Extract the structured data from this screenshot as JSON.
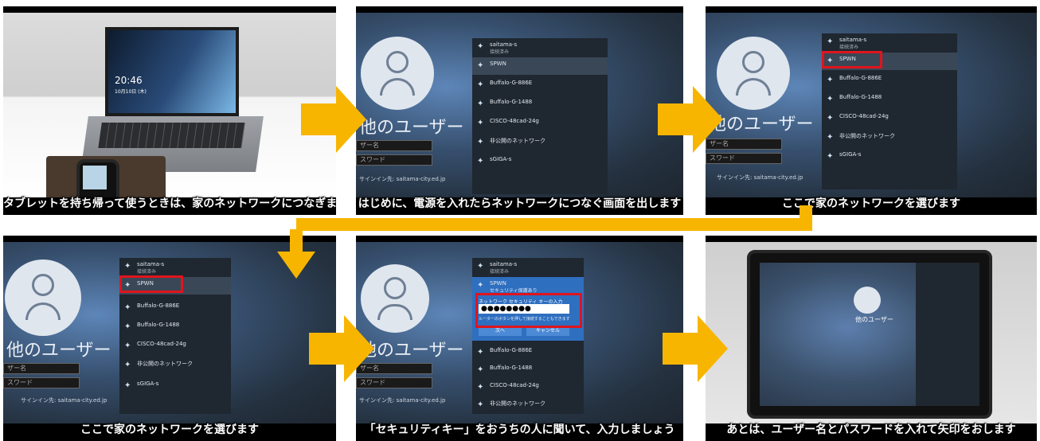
{
  "panels": [
    {
      "subtitle": "タブレットを持ち帰って使うときは、家のネットワークにつなぎます",
      "clock_time": "20:46",
      "clock_date": "10月10日 (木)"
    },
    {
      "subtitle": "はじめに、電源を入れたらネットワークにつなぐ画面を出します"
    },
    {
      "subtitle": "ここで家のネットワークを選びます"
    },
    {
      "subtitle": "ここで家のネットワークを選びます"
    },
    {
      "subtitle": "「セキュリティキー」をおうちの人に聞いて、入力しましょう"
    },
    {
      "subtitle": "あとは、ユーザー名とパスワードを入れて矢印をおします"
    }
  ],
  "login": {
    "other_user": "他のユーザー",
    "username_placeholder": "ザー名",
    "password_placeholder": "スワード",
    "signin_to": "サインイン先: saitama-city.ed.jp"
  },
  "wifi": {
    "connected_name": "saitama-s",
    "connected_status": "接続済み",
    "networks": [
      "SPWN",
      "Buffalo-G-886E",
      "Buffalo-G-1488",
      "CISCO-48cad-24g",
      "非公開のネットワーク",
      "sGIGA-s"
    ]
  },
  "security_dialog": {
    "status": "セキュリティ保護あり",
    "prompt": "ネットワーク セキュリティ キーの入力",
    "password_mask": "●●●●●●●●",
    "hint": "ルーターのボタンを押して接続することもできます",
    "next_label": "次へ",
    "cancel_label": "キャンセル"
  },
  "colors": {
    "arrow": "#f7b500",
    "highlight": "#e0141d"
  },
  "icons": {
    "network": "wifi-icon",
    "arrow": "right-arrow-icon"
  }
}
